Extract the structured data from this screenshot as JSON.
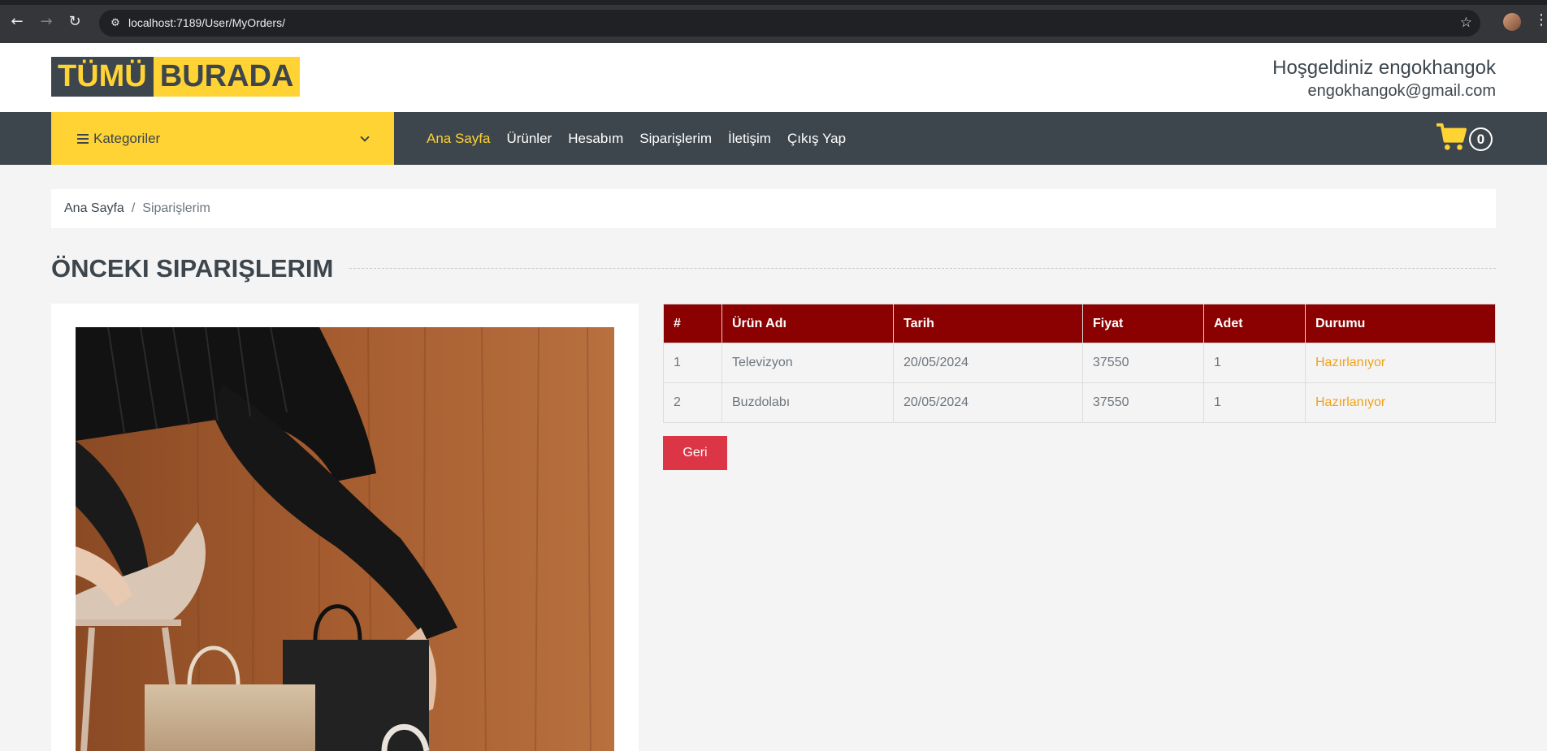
{
  "browser": {
    "back_icon": "arrow-left-icon",
    "forward_icon": "arrow-right-icon",
    "reload_icon": "reload-icon",
    "url": "localhost:7189/User/MyOrders/"
  },
  "header": {
    "logo_part1": "TÜMÜ",
    "logo_part2": "BURADA",
    "welcome_title": "Hoşgeldiniz engokhangok",
    "welcome_email": "engokhangok@gmail.com"
  },
  "navbar": {
    "categories_label": "Kategoriler",
    "items": [
      {
        "label": "Ana Sayfa",
        "active": true
      },
      {
        "label": "Ürünler",
        "active": false
      },
      {
        "label": "Hesabım",
        "active": false
      },
      {
        "label": "Siparişlerim",
        "active": false
      },
      {
        "label": "İletişim",
        "active": false
      },
      {
        "label": "Çıkış Yap",
        "active": false
      }
    ],
    "cart_count": "0"
  },
  "breadcrumb": {
    "home": "Ana Sayfa",
    "separator": "/",
    "current": "Siparişlerim"
  },
  "section_title": "ÖNCEKI SIPARIŞLERIM",
  "orders": {
    "columns": [
      "#",
      "Ürün Adı",
      "Tarih",
      "Fiyat",
      "Adet",
      "Durumu"
    ],
    "rows": [
      {
        "no": "1",
        "product": "Televizyon",
        "date": "20/05/2024",
        "price": "37550",
        "qty": "1",
        "status": "Hazırlanıyor"
      },
      {
        "no": "2",
        "product": "Buzdolabı",
        "date": "20/05/2024",
        "price": "37550",
        "qty": "1",
        "status": "Hazırlanıyor"
      }
    ]
  },
  "back_button": "Geri",
  "colors": {
    "primary": "#ffd333",
    "dark": "#3d464d",
    "table_header": "#8b0000",
    "status": "#f0a21b",
    "danger": "#dc3545"
  }
}
